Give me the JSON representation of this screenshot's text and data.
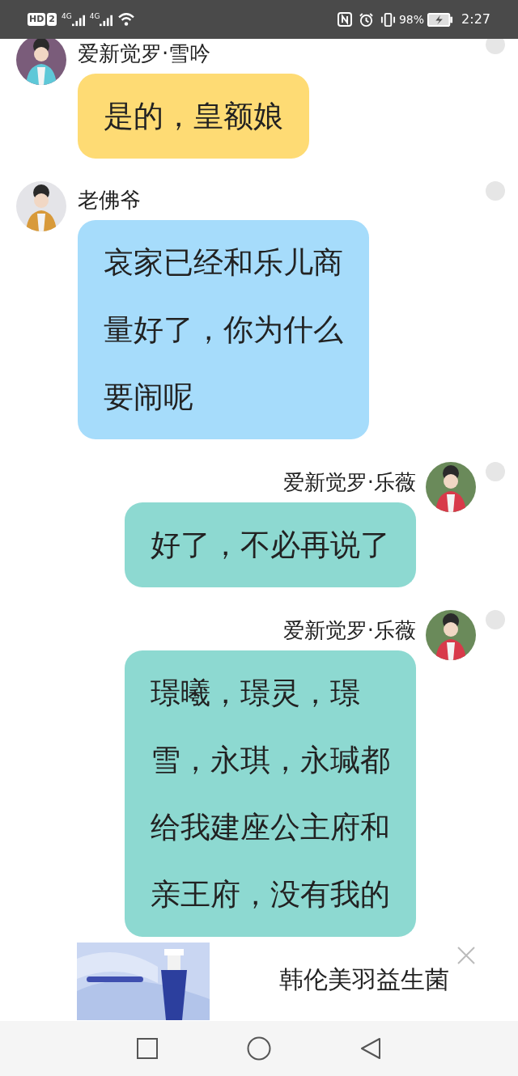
{
  "status_bar": {
    "hd": "HD",
    "sim": "2",
    "network_1": "4G",
    "network_2": "4G",
    "battery": "98%",
    "time": "2:27"
  },
  "messages": [
    {
      "kind": "incoming",
      "sender": "爱新觉罗·雪吟",
      "color": "#fedb74",
      "lines": [
        "是的，皇额娘"
      ],
      "selected": false
    },
    {
      "kind": "incoming",
      "sender": "老佛爷",
      "color": "#a6dcfb",
      "lines": [
        "哀家已经和乐儿商",
        "量好了，你为什么",
        "要闹呢"
      ],
      "selected": false
    },
    {
      "kind": "outgoing",
      "sender": "爱新觉罗·乐薇",
      "color": "#8dd9d1",
      "lines": [
        "好了，不必再说了"
      ],
      "selected": false
    },
    {
      "kind": "outgoing",
      "sender": "爱新觉罗·乐薇",
      "color": "#8dd9d1",
      "lines": [
        "璟曦，璟灵，璟",
        "雪，永琪，永瑊都",
        "给我建座公主府和",
        "亲王府，没有我的"
      ],
      "selected": false
    }
  ],
  "ad": {
    "title": "韩伦美羽益生菌"
  }
}
